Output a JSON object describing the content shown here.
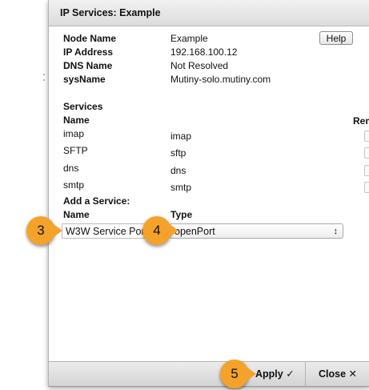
{
  "dialog": {
    "title": "IP Services: Example",
    "help_label": "Help"
  },
  "info": {
    "node_name_label": "Node Name",
    "node_name_value": "Example",
    "ip_label": "IP Address",
    "ip_value": "192.168.100.12",
    "dns_label": "DNS Name",
    "dns_value": "Not Resolved",
    "sysname_label": "sysName",
    "sysname_value": "Mutiny-solo.mutiny.com"
  },
  "services": {
    "heading": "Services",
    "name_header": "Name",
    "remove_header": "Rem",
    "rows": [
      {
        "name": "imap",
        "type": "imap"
      },
      {
        "name": "SFTP",
        "type": "sftp"
      },
      {
        "name": "dns",
        "type": "dns"
      },
      {
        "name": "smtp",
        "type": "smtp"
      }
    ]
  },
  "add_service": {
    "heading": "Add a Service:",
    "name_header": "Name",
    "type_header": "Type",
    "name_value": "W3W Service Port",
    "type_value": "openPort",
    "type_arrows": "↕"
  },
  "footer": {
    "apply_label": "Apply ✓",
    "close_label": "Close ✕"
  },
  "callouts": {
    "three": "3",
    "four": "4",
    "five": "5",
    "color": "#f5a22b"
  }
}
